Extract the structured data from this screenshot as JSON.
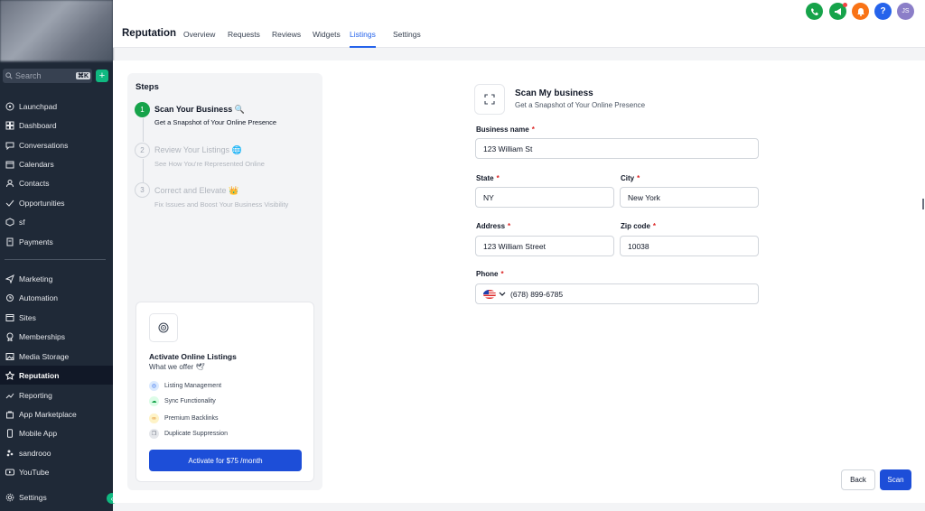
{
  "sidebar": {
    "search_placeholder": "Search",
    "search_shortcut": "⌘K",
    "plus_label": "+",
    "items": [
      {
        "label": "Launchpad",
        "icon": "launchpad-icon"
      },
      {
        "label": "Dashboard",
        "icon": "dashboard-icon"
      },
      {
        "label": "Conversations",
        "icon": "conversations-icon"
      },
      {
        "label": "Calendars",
        "icon": "calendar-icon"
      },
      {
        "label": "Contacts",
        "icon": "contacts-icon"
      },
      {
        "label": "Opportunities",
        "icon": "opportunities-icon"
      },
      {
        "label": "sf",
        "icon": "cube-icon"
      },
      {
        "label": "Payments",
        "icon": "payments-icon"
      },
      {
        "label": "Marketing",
        "icon": "send-icon"
      },
      {
        "label": "Automation",
        "icon": "automation-icon"
      },
      {
        "label": "Sites",
        "icon": "sites-icon"
      },
      {
        "label": "Memberships",
        "icon": "memberships-icon"
      },
      {
        "label": "Media Storage",
        "icon": "media-icon"
      },
      {
        "label": "Reputation",
        "icon": "star-icon"
      },
      {
        "label": "Reporting",
        "icon": "reporting-icon"
      },
      {
        "label": "App Marketplace",
        "icon": "marketplace-icon"
      },
      {
        "label": "Mobile App",
        "icon": "mobile-icon"
      },
      {
        "label": "sandrooo",
        "icon": "yelp-icon"
      },
      {
        "label": "YouTube",
        "icon": "youtube-icon"
      },
      {
        "label": "Settings",
        "icon": "gear-icon"
      }
    ],
    "active": "Reputation"
  },
  "header": {
    "title": "Reputation",
    "tabs": [
      "Overview",
      "Requests",
      "Reviews",
      "Widgets",
      "Listings",
      "Settings"
    ],
    "active_tab": "Listings",
    "avatar_initials": "JS",
    "help_label": "?"
  },
  "steps": {
    "title": "Steps",
    "items": [
      {
        "num": "1",
        "title": "Scan Your Business 🔍",
        "sub": "Get a Snapshot of Your Online Presence"
      },
      {
        "num": "2",
        "title": "Review Your Listings 🌐",
        "sub": "See How You're Represented Online"
      },
      {
        "num": "3",
        "title": "Correct and Elevate 👑",
        "sub": "Fix Issues and Boost Your Business Visibility"
      }
    ]
  },
  "promo": {
    "title": "Activate Online Listings",
    "subtitle": "What we offer 🕊",
    "features": [
      "Listing Management",
      "Sync Functionality",
      "Premium Backlinks",
      "Duplicate Suppression"
    ],
    "button": "Activate for $75 /month"
  },
  "form": {
    "title": "Scan My business",
    "subtitle": "Get a Snapshot of Your Online Presence",
    "business_name_label": "Business name",
    "business_name": "123 William St",
    "state_label": "State",
    "state": "NY",
    "city_label": "City",
    "city": "New York",
    "address_label": "Address",
    "address": "123 William Street",
    "zip_label": "Zip code",
    "zip": "10038",
    "phone_label": "Phone",
    "phone": "(678) 899-6785",
    "required_mark": "*"
  },
  "actions": {
    "back": "Back",
    "scan": "Scan"
  },
  "colors": {
    "accent": "#1d4ed8",
    "success": "#16a34a",
    "sidebar": "#1f2937"
  }
}
